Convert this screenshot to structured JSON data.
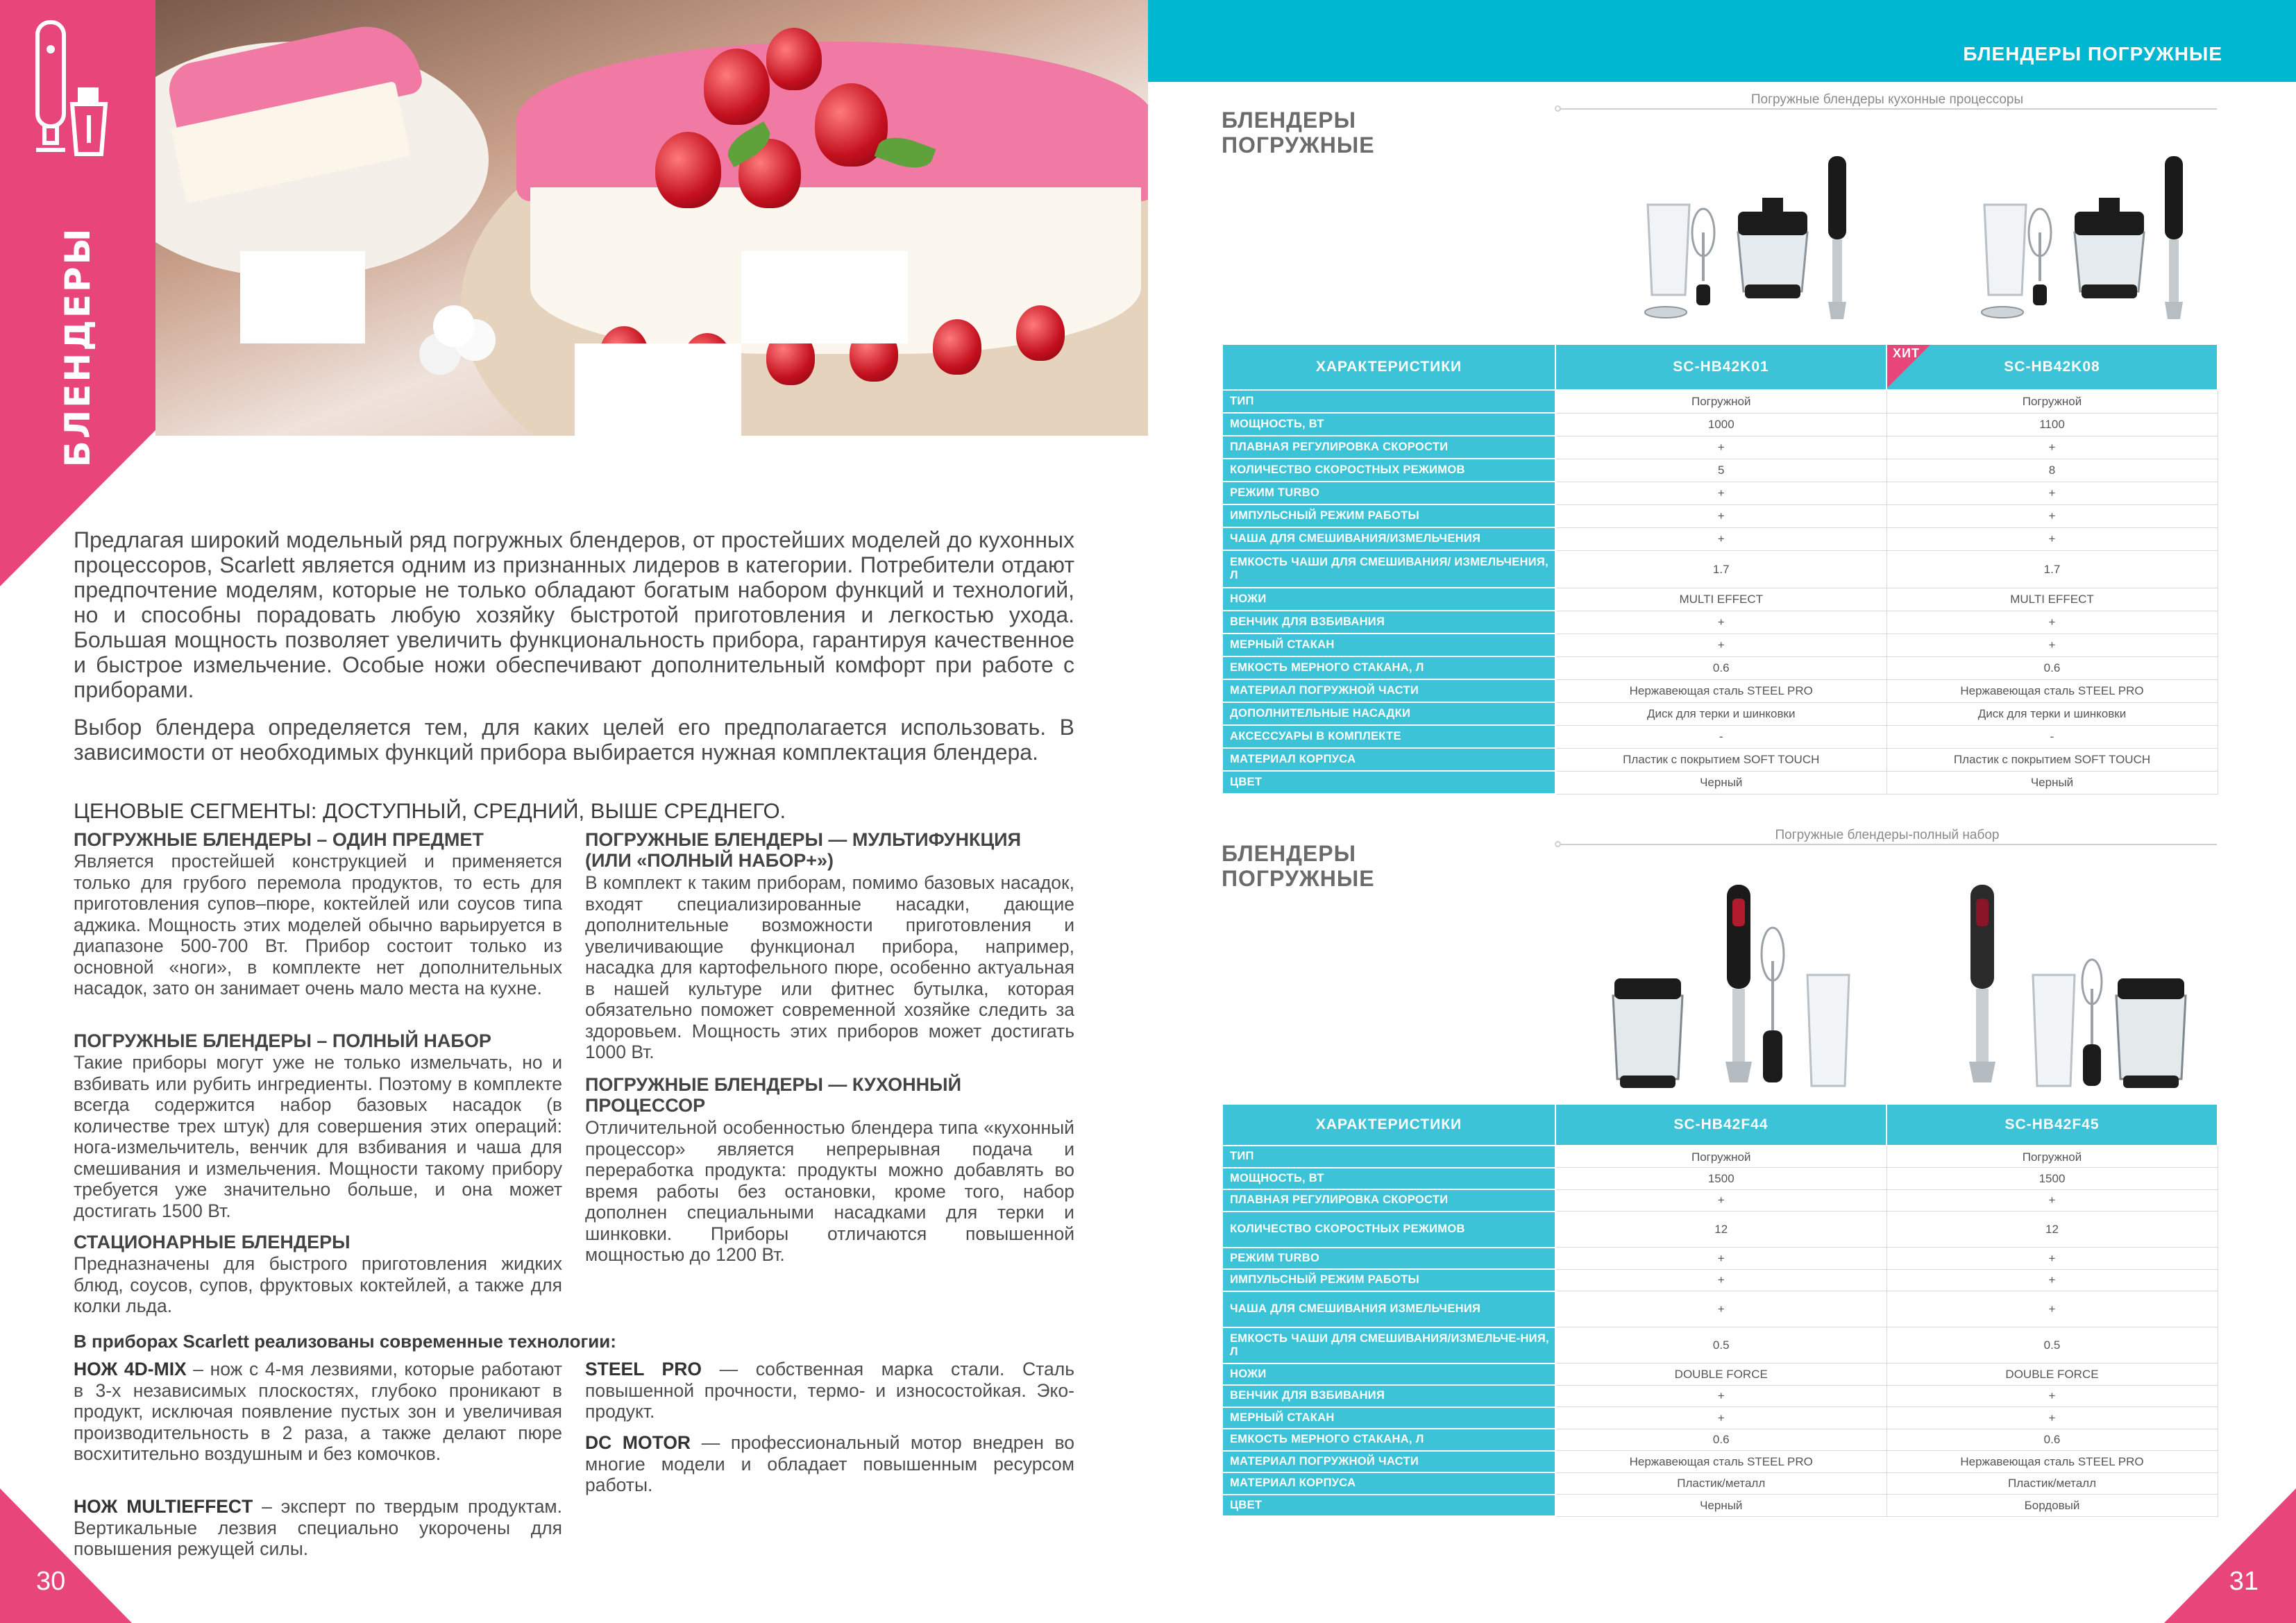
{
  "left": {
    "section_label": "БЛЕНДЕРЫ",
    "intro_p1": "Предлагая широкий модельный ряд погружных блендеров, от простейших моделей до кухонных процессоров, Scarlett является одним из признанных лидеров в категории. Потребители отдают предпочтение моделям, которые не только обладают богатым набором функций и технологий, но и способны порадовать любую хозяйку быстротой приготовления и легкостью ухода. Большая мощность позволяет увеличить функциональность прибора, гарантируя качественное и быстрое измельчение. Особые ножи обеспечивают дополнительный комфорт при работе с приборами.",
    "intro_p2": "Выбор блендера определяется тем, для каких целей его предполагается использовать. В зависимости от необходимых функций прибора выбирается нужная комплектация блендера.",
    "segments_title": "ЦЕНОВЫЕ СЕГМЕНТЫ: ДОСТУПНЫЙ, СРЕДНИЙ, ВЫШЕ СРЕДНЕГО.",
    "seg1_title": "ПОГРУЖНЫЕ БЛЕНДЕРЫ – ОДИН ПРЕДМЕТ",
    "seg1_text": "Является простейшей конструкцией и применяется только для грубого перемола продуктов, то есть для приготовления супов–пюре, коктейлей или соусов типа аджика. Мощность этих моделей обычно варьируется в диапазоне 500-700 Вт. Прибор состоит только из основной «ноги», в комплекте нет дополнительных насадок, зато он занимает очень мало места на кухне.",
    "seg2_title": "ПОГРУЖНЫЕ БЛЕНДЕРЫ – ПОЛНЫЙ НАБОР",
    "seg2_text": "Такие приборы могут уже не только измельчать, но и взбивать или рубить ингредиенты. Поэтому в комплекте всегда содержится набор базовых насадок (в количестве трех штук) для совершения этих операций: нога-измельчитель, венчик для взбивания и чаша для смешивания и измельчения. Мощности такому прибору требуется уже значительно больше, и она может достигать 1500 Вт.",
    "seg3_title": "СТАЦИОНАРНЫЕ БЛЕНДЕРЫ",
    "seg3_text": "Предназначены для быстрого приготовления жидких блюд, соусов, супов, фруктовых коктейлей, а также для колки льда.",
    "seg4_title": "ПОГРУЖНЫЕ БЛЕНДЕРЫ — МУЛЬТИФУНКЦИЯ (ИЛИ «ПОЛНЫЙ НАБОР+»)",
    "seg4_text": "В комплект к таким приборам, помимо базовых насадок, входят специализированные насадки, дающие дополнительные возможности приготовления и увеличивающие функционал прибора, например, насадка для картофельного пюре, особенно актуальная в нашей культуре или фитнес бутылка, которая обязательно поможет современной хозяйке следить за здоровьем. Мощность этих приборов может достигать 1000 Вт.",
    "seg5_title": "ПОГРУЖНЫЕ БЛЕНДЕРЫ — КУХОННЫЙ ПРОЦЕССОР",
    "seg5_text": "Отличительной особенностью блендера типа «кухонный процессор» является непрерывная подача и переработка продукта: продукты можно добавлять во время работы без остановки, кроме того, набор дополнен специальными насадками для терки и шинковки. Приборы отличаются повышенной мощностью до 1200 Вт.",
    "tech_title": "В приборах Scarlett реализованы современные технологии:",
    "tech1_name": "НОЖ 4D-MIX",
    "tech1_text": " – нож с 4-мя лезвиями, которые работают в 3-х независимых плоскостях, глубоко проникают в продукт, исключая появление пустых зон и увеличивая производительность в 2 раза, а также делают пюре восхитительно воздушным и без комочков.",
    "tech2_name": "НОЖ MULTIEFFECT",
    "tech2_text": " – эксперт по твердым продуктам. Вертикальные лезвия специально укорочены для повышения режущей силы.",
    "tech3_name": "STEEL PRO",
    "tech3_text": " — собственная марка стали. Сталь повышенной прочности, термо- и износостойкая. Эко-продукт.",
    "tech4_name": "DC MOTOR",
    "tech4_text": " — профессиональный мотор внедрен во многие модели и обладает повышенным ресурсом работы.",
    "page_number": "30"
  },
  "right": {
    "header_title": "БЛЕНДЕРЫ ПОГРУЖНЫЕ",
    "page_number": "31",
    "block1": {
      "title_line1": "БЛЕНДЕРЫ",
      "title_line2": "ПОГРУЖНЫЕ",
      "category": "Погружные блендеры кухонные процессоры",
      "col_header": "ХАРАКТЕРИСТИКИ",
      "model1": "SC-HB42K01",
      "model2": "SC-HB42K08",
      "hit_label": "ХИТ",
      "rows": [
        [
          "ТИП",
          "Погружной",
          "Погружной"
        ],
        [
          "МОЩНОСТЬ, ВТ",
          "1000",
          "1100"
        ],
        [
          "ПЛАВНАЯ РЕГУЛИРОВКА СКОРОСТИ",
          "+",
          "+"
        ],
        [
          "КОЛИЧЕСТВО СКОРОСТНЫХ РЕЖИМОВ",
          "5",
          "8"
        ],
        [
          "РЕЖИМ TURBO",
          "+",
          "+"
        ],
        [
          "ИМПУЛЬСНЫЙ РЕЖИМ РАБОТЫ",
          "+",
          "+"
        ],
        [
          "ЧАША ДЛЯ СМЕШИВАНИЯ/ИЗМЕЛЬЧЕНИЯ",
          "+",
          "+"
        ],
        [
          "ЕМКОСТЬ ЧАШИ ДЛЯ СМЕШИВАНИЯ/ ИЗМЕЛЬЧЕНИЯ, Л",
          "1.7",
          "1.7"
        ],
        [
          "НОЖИ",
          "MULTI EFFECT",
          "MULTI EFFECT"
        ],
        [
          "ВЕНЧИК ДЛЯ ВЗБИВАНИЯ",
          "+",
          "+"
        ],
        [
          "МЕРНЫЙ СТАКАН",
          "+",
          "+"
        ],
        [
          "ЕМКОСТЬ МЕРНОГО СТАКАНА, Л",
          "0.6",
          "0.6"
        ],
        [
          "МАТЕРИАЛ ПОГРУЖНОЙ ЧАСТИ",
          "Нержавеющая сталь STEEL PRO",
          "Нержавеющая сталь STEEL PRO"
        ],
        [
          "ДОПОЛНИТЕЛЬНЫЕ НАСАДКИ",
          "Диск для терки и шинковки",
          "Диск для терки и шинковки"
        ],
        [
          "АКСЕССУАРЫ В КОМПЛЕКТЕ",
          "-",
          "-"
        ],
        [
          "МАТЕРИАЛ КОРПУСА",
          "Пластик с покрытием SOFT TOUCH",
          "Пластик с покрытием SOFT TOUCH"
        ],
        [
          "ЦВЕТ",
          "Черный",
          "Черный"
        ]
      ]
    },
    "block2": {
      "title_line1": "БЛЕНДЕРЫ",
      "title_line2": "ПОГРУЖНЫЕ",
      "category": "Погружные блендеры-полный набор",
      "col_header": "ХАРАКТЕРИСТИКИ",
      "model1": "SC-HB42F44",
      "model2": "SC-HB42F45",
      "rows": [
        [
          "ТИП",
          "Погружной",
          "Погружной"
        ],
        [
          "МОЩНОСТЬ, ВТ",
          "1500",
          "1500"
        ],
        [
          "ПЛАВНАЯ РЕГУЛИРОВКА СКОРОСТИ",
          "+",
          "+"
        ],
        [
          "КОЛИЧЕСТВО СКОРОСТНЫХ РЕЖИМОВ",
          "12",
          "12"
        ],
        [
          "РЕЖИМ TURBO",
          "+",
          "+"
        ],
        [
          "ИМПУЛЬСНЫЙ РЕЖИМ РАБОТЫ",
          "+",
          "+"
        ],
        [
          "ЧАША ДЛЯ СМЕШИВАНИЯ ИЗМЕЛЬЧЕНИЯ",
          "+",
          "+"
        ],
        [
          "ЕМКОСТЬ ЧАШИ ДЛЯ СМЕШИВАНИЯ/ИЗМЕЛЬЧЕ-НИЯ, Л",
          "0.5",
          "0.5"
        ],
        [
          "НОЖИ",
          "DOUBLE FORCE",
          "DOUBLE FORCE"
        ],
        [
          "ВЕНЧИК ДЛЯ ВЗБИВАНИЯ",
          "+",
          "+"
        ],
        [
          "МЕРНЫЙ СТАКАН",
          "+",
          "+"
        ],
        [
          "ЕМКОСТЬ МЕРНОГО СТАКАНА, Л",
          "0.6",
          "0.6"
        ],
        [
          "МАТЕРИАЛ ПОГРУЖНОЙ ЧАСТИ",
          "Нержавеющая сталь STEEL PRO",
          "Нержавеющая сталь STEEL PRO"
        ],
        [
          "МАТЕРИАЛ КОРПУСА",
          "Пластик/металл",
          "Пластик/металл"
        ],
        [
          "ЦВЕТ",
          "Черный",
          "Бордовый"
        ]
      ]
    }
  }
}
